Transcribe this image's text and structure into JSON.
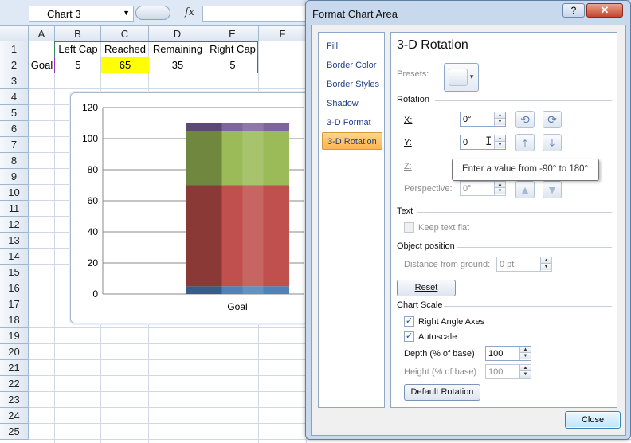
{
  "name_box": {
    "value": "Chart 3"
  },
  "formula": {
    "fx_label": "fx",
    "value": ""
  },
  "columns": [
    "A",
    "B",
    "C",
    "D",
    "E",
    "F"
  ],
  "rows": [
    "1",
    "2",
    "3",
    "4",
    "5",
    "6",
    "7",
    "8",
    "9",
    "10",
    "11",
    "12",
    "13",
    "14",
    "15",
    "16",
    "17",
    "18",
    "19",
    "20",
    "21",
    "22",
    "23",
    "24",
    "25"
  ],
  "cells": {
    "b1": "Left Cap",
    "c1": "Reached",
    "d1": "Remaining",
    "e1": "Right Cap",
    "a2": "Goal",
    "b2": "5",
    "c2": "65",
    "d2": "35",
    "e2": "5"
  },
  "colors": {
    "highlight": "#ffff00",
    "series1": "#4f81bd",
    "series2": "#c0504d",
    "series3": "#9bbb59",
    "series4": "#8064a2"
  },
  "chart_data": {
    "type": "bar",
    "stacked": true,
    "categories": [
      "Goal"
    ],
    "series": [
      {
        "name": "Left Cap",
        "values": [
          5
        ],
        "color": "#4f81bd"
      },
      {
        "name": "Reached",
        "values": [
          65
        ],
        "color": "#c0504d"
      },
      {
        "name": "Remaining",
        "values": [
          35
        ],
        "color": "#9bbb59"
      },
      {
        "name": "Right Cap",
        "values": [
          5
        ],
        "color": "#8064a2"
      }
    ],
    "yticks": [
      "0",
      "20",
      "40",
      "60",
      "80",
      "100",
      "120"
    ],
    "ylim": [
      0,
      120
    ],
    "grid": true,
    "legend": "none"
  },
  "dialog": {
    "title": "Format Chart Area",
    "help_label": "?",
    "close_x": "✕",
    "nav": [
      "Fill",
      "Border Color",
      "Border Styles",
      "Shadow",
      "3-D Format",
      "3-D Rotation"
    ],
    "active_nav": "3-D Rotation",
    "heading": "3-D Rotation",
    "presets_label": "Presets:",
    "rotation_title": "Rotation",
    "x_label": "X:",
    "x_value": "0°",
    "y_label": "Y:",
    "y_value": "0",
    "z_label": "Z:",
    "perspective_label": "Perspective:",
    "perspective_value": "0°",
    "text_title": "Text",
    "keep_text_flat": "Keep text flat",
    "object_position_title": "Object position",
    "distance_label": "Distance from ground:",
    "distance_value": "0 pt",
    "reset_label": "Reset",
    "chart_scale_title": "Chart Scale",
    "right_angle_axes": "Right Angle Axes",
    "autoscale": "Autoscale",
    "depth_label": "Depth (% of base)",
    "depth_value": "100",
    "height_label": "Height (% of base)",
    "height_value": "100",
    "default_rotation_label": "Default Rotation",
    "close_label": "Close"
  },
  "tooltip": {
    "text": "Enter a value from -90° to 180°"
  }
}
